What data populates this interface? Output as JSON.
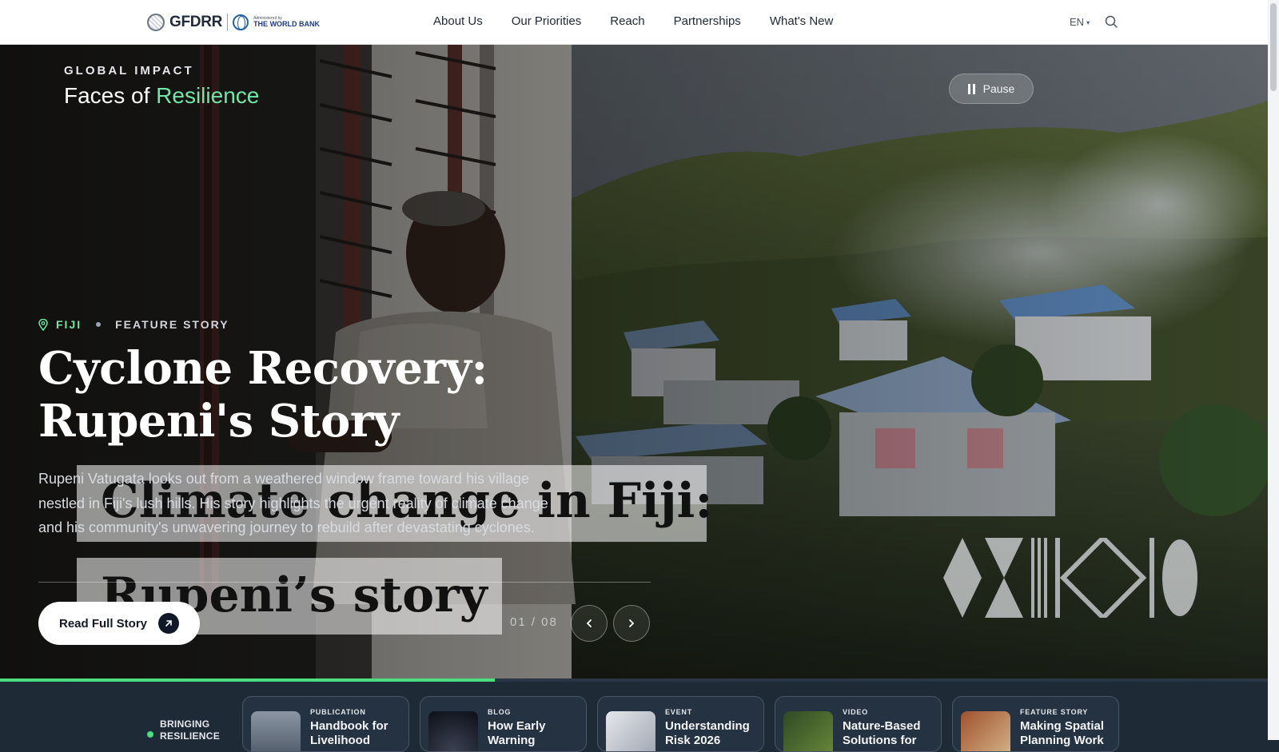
{
  "header": {
    "logo_text": "GFDRR",
    "wb_small": "Administered by",
    "wb_name": "THE WORLD BANK",
    "nav": [
      "About Us",
      "Our Priorities",
      "Reach",
      "Partnerships",
      "What's New"
    ],
    "lang": "EN",
    "search_icon": "search-icon"
  },
  "hero": {
    "kicker": "GLOBAL IMPACT",
    "title_prefix": "Faces of ",
    "title_accent": "Resilience",
    "pause_label": "Pause",
    "location": "FIJI",
    "story_type": "FEATURE STORY",
    "story_title": "Cyclone Recovery: Rupeni's Story",
    "description": "Rupeni Vatugata looks out from a weathered window frame toward his village nestled in Fiji's lush hills. His story highlights the urgent reality of climate change and his community's unwavering journey to rebuild after devastating cyclones.",
    "overlay_line1": "Climate change in Fiji:",
    "overlay_line2": "Rupeni’s story",
    "read_button": "Read Full Story",
    "counter": "01 / 08",
    "progress": 0.39,
    "accent_color": "#6ee7a7"
  },
  "strip": {
    "label_line1": "BRINGING",
    "label_line2": "RESILIENCE",
    "cards": [
      {
        "type": "PUBLICATION",
        "title": "Handbook for Livelihood"
      },
      {
        "type": "BLOG",
        "title": "How Early Warning"
      },
      {
        "type": "EVENT",
        "title": "Understanding Risk 2026"
      },
      {
        "type": "VIDEO",
        "title": "Nature-Based Solutions for"
      },
      {
        "type": "FEATURE STORY",
        "title": "Making Spatial Planning Work"
      }
    ]
  }
}
